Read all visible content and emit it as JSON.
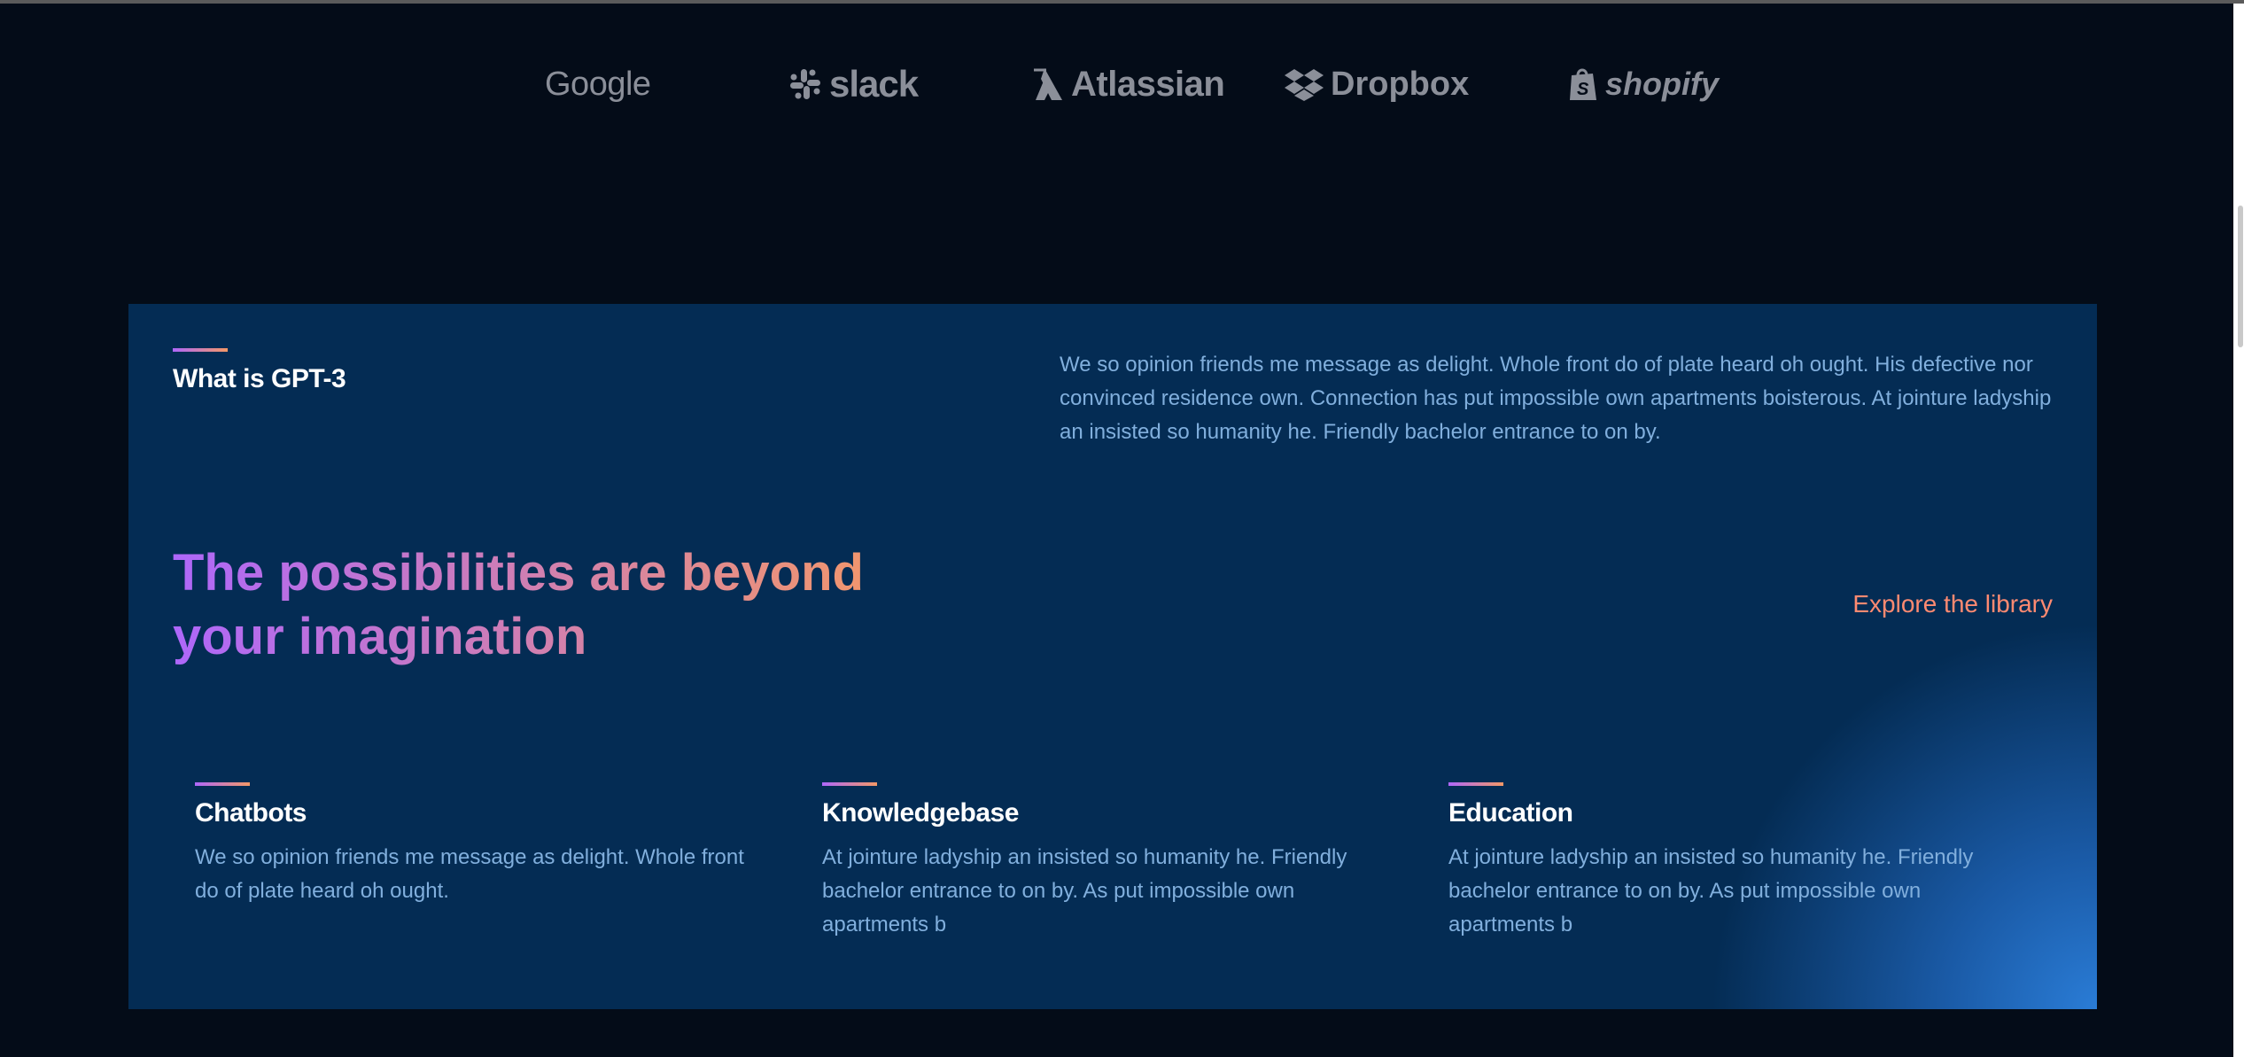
{
  "brands": [
    {
      "name": "Google",
      "icon": "google-logo"
    },
    {
      "name": "slack",
      "icon": "slack-logo"
    },
    {
      "name": "Atlassian",
      "icon": "atlassian-logo"
    },
    {
      "name": "Dropbox",
      "icon": "dropbox-logo"
    },
    {
      "name": "shopify",
      "icon": "shopify-logo"
    }
  ],
  "what": {
    "title": "What is GPT-3",
    "text": "We so opinion friends me message as delight. Whole front do of plate heard oh ought. His defective nor convinced residence own. Connection has put impossible own apartments boisterous. At jointure ladyship an insisted so humanity he. Friendly bachelor entrance to on by."
  },
  "headline": "The possibilities are beyond your imagination",
  "explore_label": "Explore the library",
  "features": [
    {
      "title": "Chatbots",
      "text": "We so opinion friends me message as delight. Whole front do of plate heard oh ought."
    },
    {
      "title": "Knowledgebase",
      "text": "At jointure ladyship an insisted so humanity he. Friendly bachelor entrance to on by. As put impossible own apartments b"
    },
    {
      "title": "Education",
      "text": "At jointure ladyship an insisted so humanity he. Friendly bachelor entrance to on by. As put impossible own apartments b"
    }
  ],
  "colors": {
    "background": "#040C18",
    "panel": "#042C54",
    "accent_gradient_start": "#AE67FA",
    "accent_gradient_end": "#F49867",
    "link": "#FF8A71",
    "body_text": "#81AFDD",
    "logo_gray": "#8b8f99"
  }
}
